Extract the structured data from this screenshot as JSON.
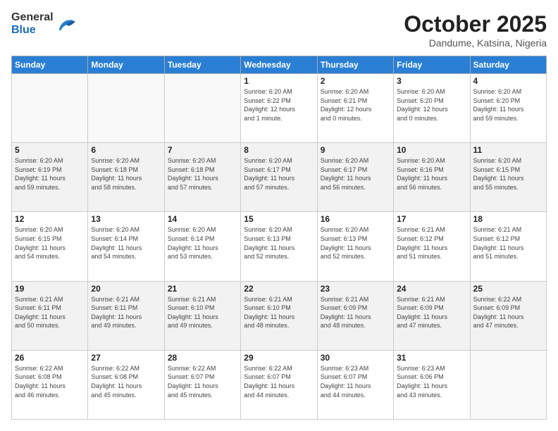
{
  "logo": {
    "general": "General",
    "blue": "Blue"
  },
  "title": "October 2025",
  "subtitle": "Dandume, Katsina, Nigeria",
  "days_of_week": [
    "Sunday",
    "Monday",
    "Tuesday",
    "Wednesday",
    "Thursday",
    "Friday",
    "Saturday"
  ],
  "weeks": [
    [
      {
        "day": "",
        "info": ""
      },
      {
        "day": "",
        "info": ""
      },
      {
        "day": "",
        "info": ""
      },
      {
        "day": "1",
        "info": "Sunrise: 6:20 AM\nSunset: 6:22 PM\nDaylight: 12 hours\nand 1 minute."
      },
      {
        "day": "2",
        "info": "Sunrise: 6:20 AM\nSunset: 6:21 PM\nDaylight: 12 hours\nand 0 minutes."
      },
      {
        "day": "3",
        "info": "Sunrise: 6:20 AM\nSunset: 6:20 PM\nDaylight: 12 hours\nand 0 minutes."
      },
      {
        "day": "4",
        "info": "Sunrise: 6:20 AM\nSunset: 6:20 PM\nDaylight: 11 hours\nand 59 minutes."
      }
    ],
    [
      {
        "day": "5",
        "info": "Sunrise: 6:20 AM\nSunset: 6:19 PM\nDaylight: 11 hours\nand 59 minutes."
      },
      {
        "day": "6",
        "info": "Sunrise: 6:20 AM\nSunset: 6:18 PM\nDaylight: 11 hours\nand 58 minutes."
      },
      {
        "day": "7",
        "info": "Sunrise: 6:20 AM\nSunset: 6:18 PM\nDaylight: 11 hours\nand 57 minutes."
      },
      {
        "day": "8",
        "info": "Sunrise: 6:20 AM\nSunset: 6:17 PM\nDaylight: 11 hours\nand 57 minutes."
      },
      {
        "day": "9",
        "info": "Sunrise: 6:20 AM\nSunset: 6:17 PM\nDaylight: 11 hours\nand 56 minutes."
      },
      {
        "day": "10",
        "info": "Sunrise: 6:20 AM\nSunset: 6:16 PM\nDaylight: 11 hours\nand 56 minutes."
      },
      {
        "day": "11",
        "info": "Sunrise: 6:20 AM\nSunset: 6:15 PM\nDaylight: 11 hours\nand 55 minutes."
      }
    ],
    [
      {
        "day": "12",
        "info": "Sunrise: 6:20 AM\nSunset: 6:15 PM\nDaylight: 11 hours\nand 54 minutes."
      },
      {
        "day": "13",
        "info": "Sunrise: 6:20 AM\nSunset: 6:14 PM\nDaylight: 11 hours\nand 54 minutes."
      },
      {
        "day": "14",
        "info": "Sunrise: 6:20 AM\nSunset: 6:14 PM\nDaylight: 11 hours\nand 53 minutes."
      },
      {
        "day": "15",
        "info": "Sunrise: 6:20 AM\nSunset: 6:13 PM\nDaylight: 11 hours\nand 52 minutes."
      },
      {
        "day": "16",
        "info": "Sunrise: 6:20 AM\nSunset: 6:13 PM\nDaylight: 11 hours\nand 52 minutes."
      },
      {
        "day": "17",
        "info": "Sunrise: 6:21 AM\nSunset: 6:12 PM\nDaylight: 11 hours\nand 51 minutes."
      },
      {
        "day": "18",
        "info": "Sunrise: 6:21 AM\nSunset: 6:12 PM\nDaylight: 11 hours\nand 51 minutes."
      }
    ],
    [
      {
        "day": "19",
        "info": "Sunrise: 6:21 AM\nSunset: 6:11 PM\nDaylight: 11 hours\nand 50 minutes."
      },
      {
        "day": "20",
        "info": "Sunrise: 6:21 AM\nSunset: 6:11 PM\nDaylight: 11 hours\nand 49 minutes."
      },
      {
        "day": "21",
        "info": "Sunrise: 6:21 AM\nSunset: 6:10 PM\nDaylight: 11 hours\nand 49 minutes."
      },
      {
        "day": "22",
        "info": "Sunrise: 6:21 AM\nSunset: 6:10 PM\nDaylight: 11 hours\nand 48 minutes."
      },
      {
        "day": "23",
        "info": "Sunrise: 6:21 AM\nSunset: 6:09 PM\nDaylight: 11 hours\nand 48 minutes."
      },
      {
        "day": "24",
        "info": "Sunrise: 6:21 AM\nSunset: 6:09 PM\nDaylight: 11 hours\nand 47 minutes."
      },
      {
        "day": "25",
        "info": "Sunrise: 6:22 AM\nSunset: 6:09 PM\nDaylight: 11 hours\nand 47 minutes."
      }
    ],
    [
      {
        "day": "26",
        "info": "Sunrise: 6:22 AM\nSunset: 6:08 PM\nDaylight: 11 hours\nand 46 minutes."
      },
      {
        "day": "27",
        "info": "Sunrise: 6:22 AM\nSunset: 6:08 PM\nDaylight: 11 hours\nand 45 minutes."
      },
      {
        "day": "28",
        "info": "Sunrise: 6:22 AM\nSunset: 6:07 PM\nDaylight: 11 hours\nand 45 minutes."
      },
      {
        "day": "29",
        "info": "Sunrise: 6:22 AM\nSunset: 6:07 PM\nDaylight: 11 hours\nand 44 minutes."
      },
      {
        "day": "30",
        "info": "Sunrise: 6:23 AM\nSunset: 6:07 PM\nDaylight: 11 hours\nand 44 minutes."
      },
      {
        "day": "31",
        "info": "Sunrise: 6:23 AM\nSunset: 6:06 PM\nDaylight: 11 hours\nand 43 minutes."
      },
      {
        "day": "",
        "info": ""
      }
    ]
  ]
}
